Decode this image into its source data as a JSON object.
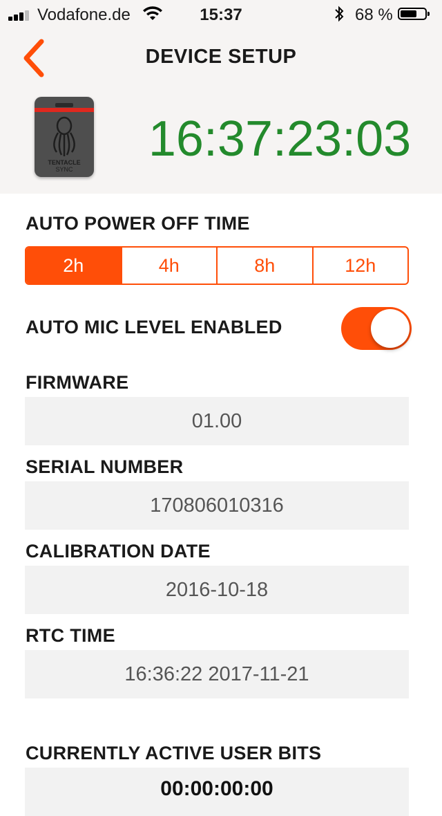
{
  "status_bar": {
    "carrier": "Vodafone.de",
    "time": "15:37",
    "battery_percent": "68 %",
    "battery_level": 0.68
  },
  "header": {
    "title": "DEVICE SETUP",
    "timecode": "16:37:23:03",
    "timecode_color": "#238a2c",
    "device_brand_line1": "TENTACLE",
    "device_brand_line2": "SYNC"
  },
  "auto_power_off": {
    "label": "AUTO POWER OFF TIME",
    "options": [
      "2h",
      "4h",
      "8h",
      "12h"
    ],
    "selected": "2h"
  },
  "auto_mic": {
    "label": "AUTO MIC LEVEL ENABLED",
    "enabled": true
  },
  "firmware": {
    "label": "FIRMWARE",
    "value": "01.00"
  },
  "serial_number": {
    "label": "SERIAL NUMBER",
    "value": "170806010316"
  },
  "calibration_date": {
    "label": "CALIBRATION DATE",
    "value": "2016-10-18"
  },
  "rtc_time": {
    "label": "RTC TIME",
    "value": "16:36:22 2017-11-21"
  },
  "user_bits": {
    "label": "CURRENTLY ACTIVE USER BITS",
    "value": "00:00:00:00"
  },
  "colors": {
    "accent": "#ff4e08",
    "timecode": "#238a2c",
    "value_bg": "#f2f2f2"
  }
}
